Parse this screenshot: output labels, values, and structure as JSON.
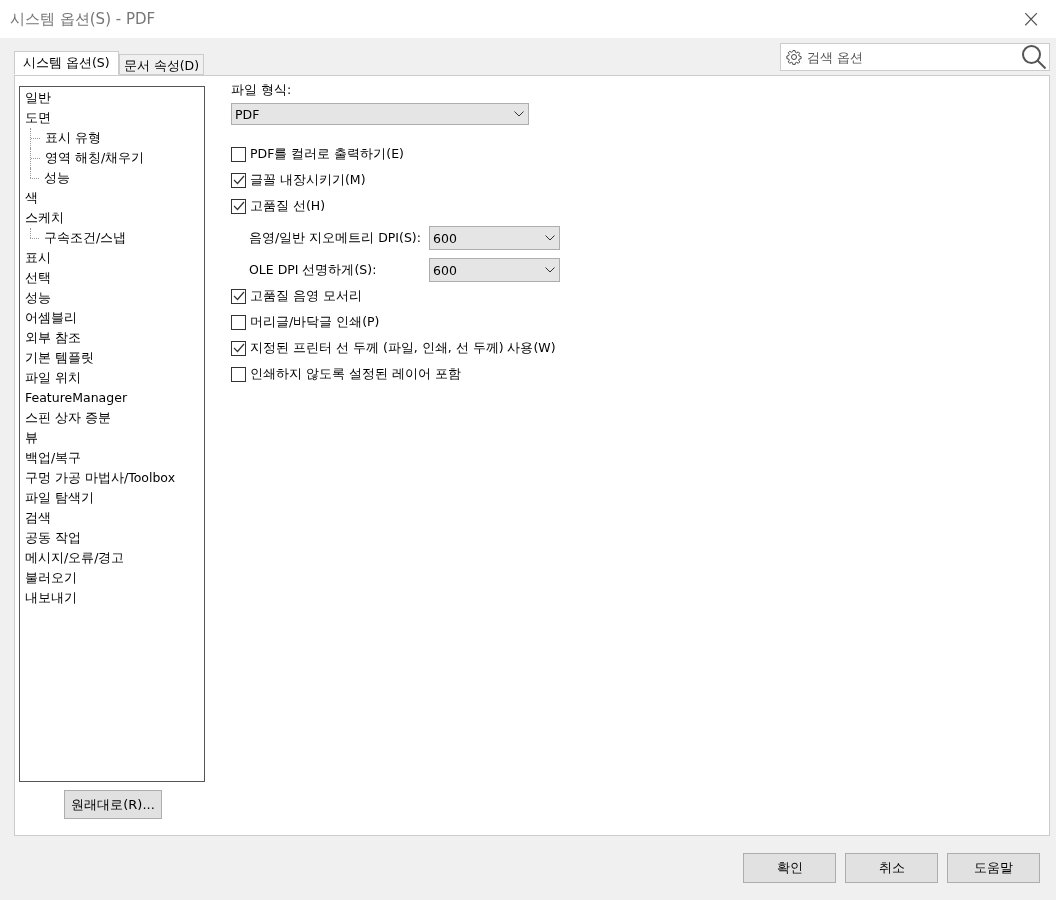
{
  "window": {
    "title": "시스템 옵션(S) - PDF",
    "close": "×"
  },
  "tabs": [
    {
      "label": "시스템 옵션(S)",
      "selected": true
    },
    {
      "label": "문서 속성(D)",
      "selected": false
    }
  ],
  "search": {
    "placeholder": "검색 옵션"
  },
  "tree": [
    {
      "label": "일반"
    },
    {
      "label": "도면",
      "children": [
        {
          "label": "표시 유형"
        },
        {
          "label": "영역 해칭/채우기"
        },
        {
          "label": "성능"
        }
      ]
    },
    {
      "label": "색"
    },
    {
      "label": "스케치",
      "children": [
        {
          "label": "구속조건/스냅"
        }
      ]
    },
    {
      "label": "표시"
    },
    {
      "label": "선택"
    },
    {
      "label": "성능"
    },
    {
      "label": "어셈블리"
    },
    {
      "label": "외부 참조"
    },
    {
      "label": "기본 템플릿"
    },
    {
      "label": "파일 위치"
    },
    {
      "label": "FeatureManager"
    },
    {
      "label": "스핀 상자 증분"
    },
    {
      "label": "뷰"
    },
    {
      "label": "백업/복구"
    },
    {
      "label": "구멍 가공 마법사/Toolbox"
    },
    {
      "label": "파일 탐색기"
    },
    {
      "label": "검색"
    },
    {
      "label": "공동 작업"
    },
    {
      "label": "메시지/오류/경고"
    },
    {
      "label": "불러오기"
    },
    {
      "label": "내보내기"
    }
  ],
  "reset_button": "원래대로(R)...",
  "file_format": {
    "label": "파일 형식:",
    "value": "PDF"
  },
  "options": [
    {
      "kind": "checkbox",
      "label": "PDF를 컬러로 출력하기(E)",
      "checked": false
    },
    {
      "kind": "checkbox",
      "label": "글꼴 내장시키기(M)",
      "checked": true
    },
    {
      "kind": "checkbox",
      "label": "고품질 선(H)",
      "checked": true
    },
    {
      "kind": "select",
      "label": "음영/일반 지오메트리 DPI(S):",
      "value": "600"
    },
    {
      "kind": "select",
      "label": "OLE DPI 선명하게(S):",
      "value": "600"
    },
    {
      "kind": "checkbox",
      "label": "고품질 음영 모서리",
      "checked": true
    },
    {
      "kind": "checkbox",
      "label": "머리글/바닥글 인쇄(P)",
      "checked": false
    },
    {
      "kind": "checkbox",
      "label": "지정된 프린터 선 두께 (파일, 인쇄, 선 두께) 사용(W)",
      "checked": true
    },
    {
      "kind": "checkbox",
      "label": "인쇄하지 않도록 설정된 레이어 포함",
      "checked": false
    }
  ],
  "buttons": [
    "확인",
    "취소",
    "도움말"
  ]
}
